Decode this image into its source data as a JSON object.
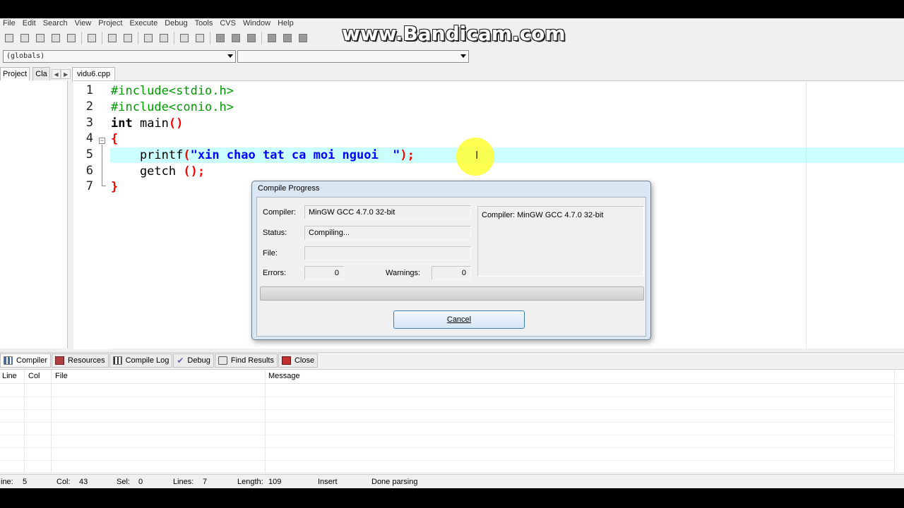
{
  "watermark": "www.Bandicam.com",
  "menu": [
    "File",
    "Edit",
    "Search",
    "View",
    "Project",
    "Execute",
    "Debug",
    "Tools",
    "CVS",
    "Window",
    "Help"
  ],
  "combos": {
    "scope": "(globals)",
    "symbol": ""
  },
  "left_tabs": {
    "project": "Project",
    "classes": "Cla"
  },
  "file_tab": "vidu6.cpp",
  "line_numbers": [
    "1",
    "2",
    "3",
    "4",
    "5",
    "6",
    "7"
  ],
  "code": {
    "l1": "#include<stdio.h>",
    "l2": "#include<conio.h>",
    "l3_kw": "int",
    "l3_rest": " main",
    "l3_sym": "()",
    "l4": "{",
    "l5_fn": "    printf",
    "l5_open": "(",
    "l5_str": "\"xin chao tat ca moi nguoi  \"",
    "l5_close": ");",
    "l6_fn": "    getch ",
    "l6_sym": "();",
    "l7": "}"
  },
  "dialog": {
    "title": "Compile Progress",
    "compiler_label": "Compiler:",
    "compiler_value": "MinGW GCC 4.7.0 32-bit",
    "status_label": "Status:",
    "status_value": "Compiling...",
    "file_label": "File:",
    "file_value": "",
    "errors_label": "Errors:",
    "errors_value": "0",
    "warnings_label": "Warnings:",
    "warnings_value": "0",
    "log_text": "Compiler: MinGW GCC 4.7.0 32-bit",
    "progress": 0,
    "cancel_label": "Cancel"
  },
  "bottom_tabs": [
    "Compiler",
    "Resources",
    "Compile Log",
    "Debug",
    "Find Results",
    "Close"
  ],
  "messages": {
    "columns": [
      "Line",
      "Col",
      "File",
      "Message"
    ]
  },
  "status": {
    "line_label": "ine:",
    "line_value": "5",
    "col_label": "Col:",
    "col_value": "43",
    "sel_label": "Sel:",
    "sel_value": "0",
    "lines_label": "Lines:",
    "lines_value": "7",
    "length_label": "Length:",
    "length_value": "109",
    "mode": "Insert",
    "message": "Done parsing"
  }
}
